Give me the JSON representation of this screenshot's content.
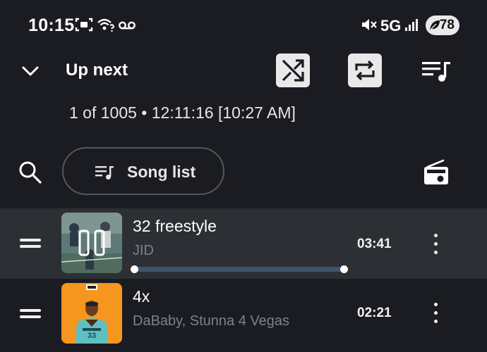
{
  "status_bar": {
    "time": "10:15",
    "network": "5G",
    "battery": "78",
    "left_icons": [
      "screenshot-icon",
      "wifi-question-icon",
      "voicemail-icon"
    ],
    "right_icons": [
      "mute-icon",
      "signal-icon",
      "battery-saver-icon"
    ]
  },
  "header": {
    "title": "Up next",
    "queue_info": "1 of 1005 • 12:11:16 [10:27 AM]",
    "shuffle_on": true,
    "repeat_on": true
  },
  "toolbar": {
    "song_list_label": "Song list"
  },
  "tracks": [
    {
      "title": "32 freestyle",
      "artist": "JID",
      "duration": "03:41",
      "playing": true,
      "progress": 1.0
    },
    {
      "title": "4x",
      "artist": "DaBaby, Stunna 4 Vegas",
      "duration": "02:21",
      "playing": false
    }
  ],
  "colors": {
    "background": "#1b1c21",
    "active_row": "#2c3035",
    "toggle_on": "#e9e9e9",
    "progress_track": "#3f5466",
    "secondary_text": "#7e8288",
    "art_orange": "#f5961f"
  }
}
